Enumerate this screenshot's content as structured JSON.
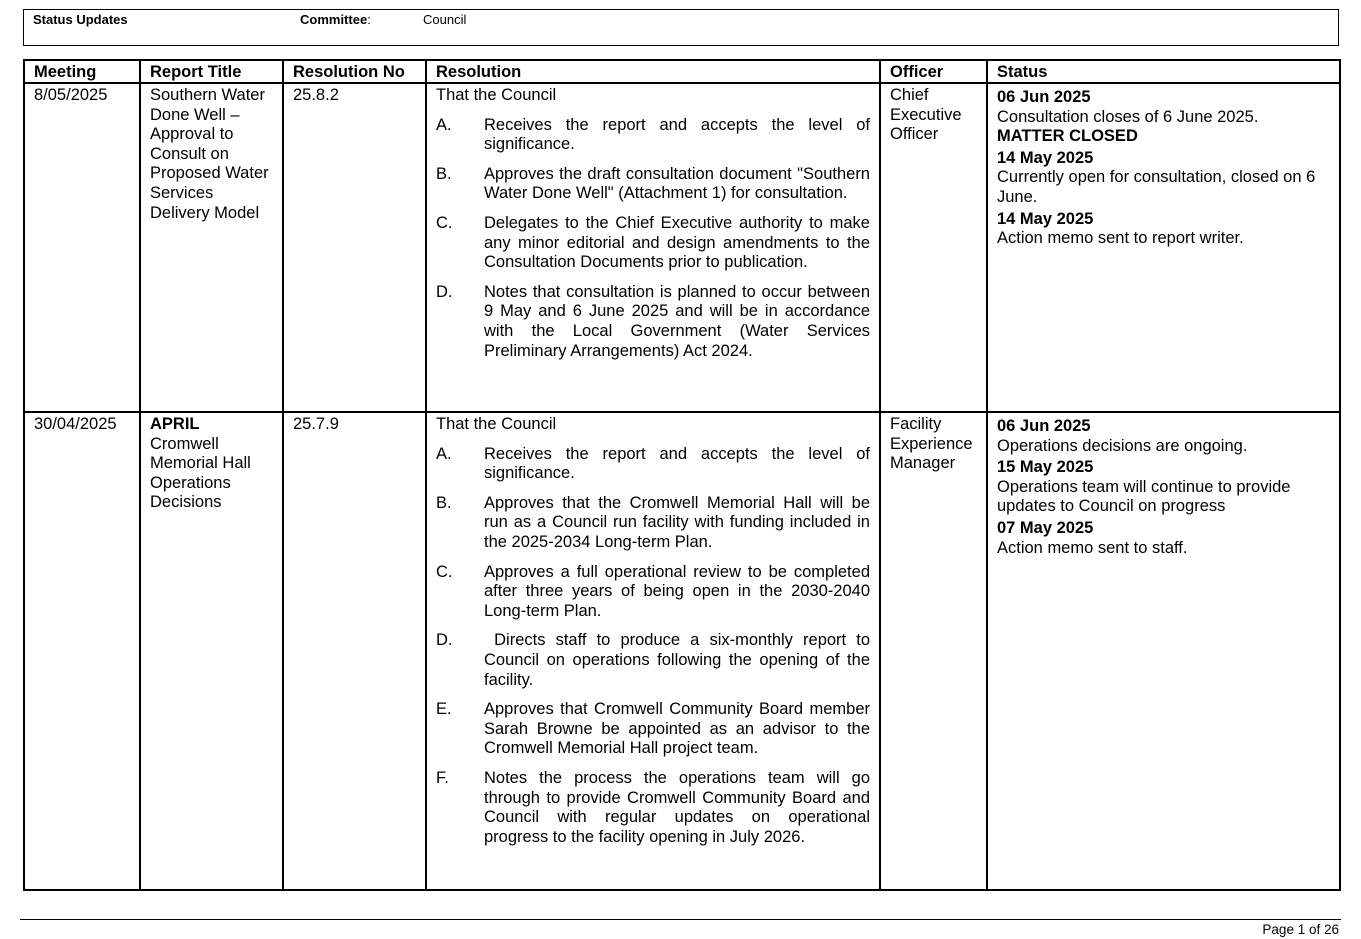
{
  "header": {
    "title": "Status Updates",
    "committee_label": "Committee",
    "committee_value": "Council"
  },
  "columns": [
    "Meeting",
    "Report Title",
    "Resolution No",
    "Resolution",
    "Officer",
    "Status"
  ],
  "rows": [
    {
      "meeting": "8/05/2025",
      "report_title_bold": "",
      "report_title": "Southern Water Done Well – Approval to Consult on Proposed Water Services Delivery Model",
      "resolution_no": "25.8.2",
      "resolution_intro": "That the Council",
      "resolution_items": [
        {
          "letter": "A.",
          "text": "Receives the report and accepts the level of significance."
        },
        {
          "letter": "B.",
          "text": "Approves the draft consultation document \"Southern Water Done Well\" (Attachment 1) for consultation."
        },
        {
          "letter": "C.",
          "text": "Delegates to the Chief Executive authority to make any minor editorial and design amendments to the Consultation Documents prior to publication."
        },
        {
          "letter": "D.",
          "text": "Notes that consultation is planned to occur between 9 May and 6 June 2025 and will be in accordance with the Local Government (Water Services Preliminary Arrangements) Act 2024."
        }
      ],
      "officer": "Chief Executive Officer",
      "status": [
        {
          "date": "06 Jun 2025",
          "text": "Consultation closes of 6 June 2025.",
          "closed": "MATTER CLOSED"
        },
        {
          "date": "14 May 2025",
          "text": "Currently open for consultation, closed on 6 June.",
          "closed": ""
        },
        {
          "date": "14 May 2025",
          "text": "Action memo sent to report writer.",
          "closed": ""
        }
      ]
    },
    {
      "meeting": "30/04/2025",
      "report_title_bold": "APRIL",
      "report_title": "Cromwell Memorial Hall Operations Decisions",
      "resolution_no": "25.7.9",
      "resolution_intro": "That the Council",
      "resolution_items": [
        {
          "letter": "A.",
          "text": "Receives the report and accepts the level of significance."
        },
        {
          "letter": "B.",
          "text": "Approves that the Cromwell Memorial Hall will be run as a Council run facility with funding included in the 2025-2034 Long-term Plan."
        },
        {
          "letter": "C.",
          "text": "Approves a full operational review to be completed after three years of being open in the 2030-2040 Long-term Plan."
        },
        {
          "letter": "D.",
          "text": " Directs staff to produce a six-monthly report to Council on operations following the opening of the facility."
        },
        {
          "letter": "E.",
          "text": "Approves that Cromwell Community Board member Sarah Browne be appointed as an advisor to the Cromwell Memorial Hall project team."
        },
        {
          "letter": "F.",
          "text": "Notes the process the operations team will go through to provide Cromwell Community Board and Council with regular updates on operational progress to the facility opening in July 2026."
        }
      ],
      "officer": "Facility Experience Manager",
      "status": [
        {
          "date": "06 Jun 2025",
          "text": "Operations decisions are ongoing.",
          "closed": ""
        },
        {
          "date": "15 May 2025",
          "text": "Operations team will continue to provide updates to Council on progress",
          "closed": ""
        },
        {
          "date": "07 May 2025",
          "text": "Action memo sent to staff.",
          "closed": ""
        }
      ]
    }
  ],
  "footer": {
    "page": "Page 1 of 26"
  }
}
